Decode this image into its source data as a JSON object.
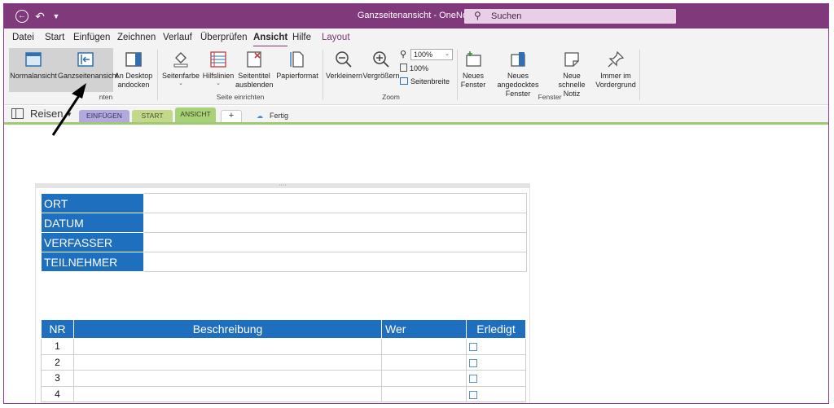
{
  "titlebar": {
    "title": "Ganzseitenansicht - OneNote",
    "search_placeholder": "Suchen"
  },
  "menu": {
    "tabs": [
      {
        "label": "Datei"
      },
      {
        "label": "Start"
      },
      {
        "label": "Einfügen"
      },
      {
        "label": "Zeichnen"
      },
      {
        "label": "Verlauf"
      },
      {
        "label": "Überprüfen"
      },
      {
        "label": "Ansicht"
      },
      {
        "label": "Hilfe"
      },
      {
        "label": "Layout"
      }
    ],
    "active": "Ansicht"
  },
  "ribbon": {
    "ansichten": {
      "normalansicht": "Normalansicht",
      "ganzseitenansicht": "Ganzseitenansicht",
      "desktop_line1": "An Desktop",
      "desktop_line2": "andocken",
      "label": "nten"
    },
    "seite": {
      "seitenfarbe": "Seitenfarbe",
      "hilfslinien": "Hilfslinien",
      "seitentitel_line1": "Seitentitel",
      "seitentitel_line2": "ausblenden",
      "papierformat": "Papierformat",
      "label": "Seite einrichten"
    },
    "zoom": {
      "verkleinern": "Verkleinern",
      "vergroessern": "Vergrößern",
      "combo_value": "100%",
      "hundert": "100%",
      "seitenbreite": "Seitenbreite",
      "label": "Zoom"
    },
    "fenster": {
      "neues_line1": "Neues",
      "neues_line2": "Fenster",
      "angedockt_line1": "Neues angedocktes",
      "angedockt_line2": "Fenster",
      "notiz_line1": "Neue schnelle",
      "notiz_line2": "Notiz",
      "vordergrund_line1": "Immer im",
      "vordergrund_line2": "Vordergrund",
      "label": "Fenster"
    }
  },
  "notebook": {
    "name": "Reisen",
    "sections": [
      "EINFÜGEN",
      "START",
      "ANSICHT",
      "+"
    ],
    "fertig": "Fertig"
  },
  "info_table": {
    "labels": [
      "ORT",
      "DATUM",
      "VERFASSER",
      "TEILNEHMER"
    ]
  },
  "task_table": {
    "headers": [
      "NR",
      "Beschreibung",
      "Wer",
      "Erledigt"
    ],
    "rows": [
      "1",
      "2",
      "3",
      "4"
    ]
  },
  "colors": {
    "title_bar": "#80397b",
    "table_header": "#1f6fbf",
    "section_green": "#9dcb72"
  }
}
